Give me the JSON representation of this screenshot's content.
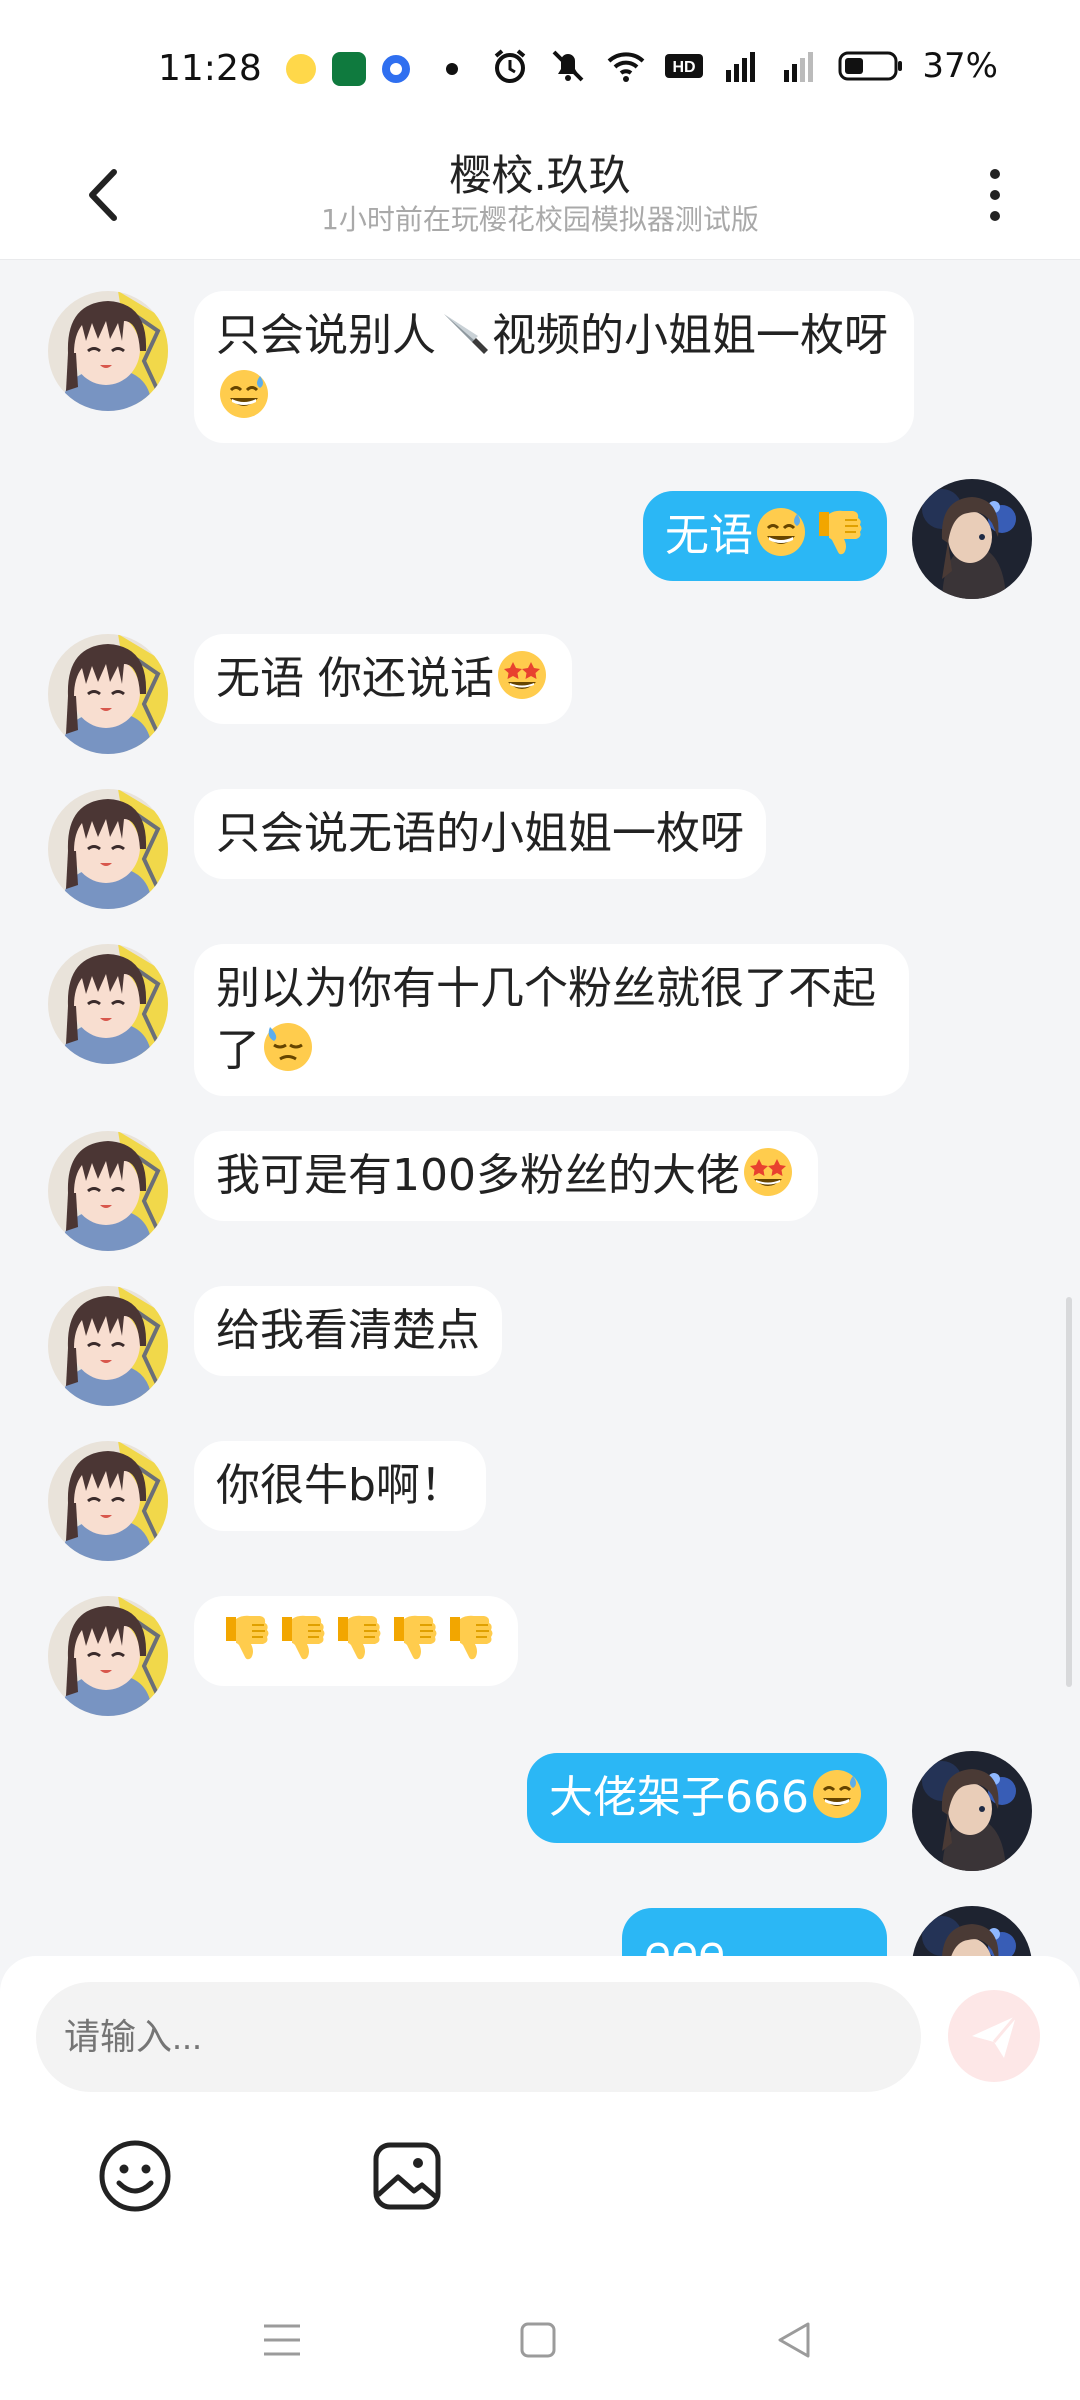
{
  "status_bar": {
    "time": "11:28",
    "battery": "37%"
  },
  "header": {
    "title": "樱校.玖玖",
    "subtitle": "1小时前在玩樱花校园模拟器测试版"
  },
  "messages": [
    {
      "side": "left",
      "text": "只会说别人",
      "emoji": "knife",
      "text2": "视频的小姐姐一枚呀",
      "emoji2": "sweat-smile"
    },
    {
      "side": "right",
      "text": "无语",
      "emojis": [
        "sweat-smile",
        "thumbs-down"
      ]
    },
    {
      "side": "left",
      "text": "无语 你还说话",
      "emojis": [
        "star-struck"
      ]
    },
    {
      "side": "left",
      "text": "只会说无语的小姐姐一枚呀"
    },
    {
      "side": "left",
      "text": "别以为你有十几个粉丝就很了不起了",
      "emojis": [
        "downcast-sweat"
      ]
    },
    {
      "side": "left",
      "text": "我可是有100多粉丝的大佬",
      "emojis": [
        "star-struck"
      ]
    },
    {
      "side": "left",
      "text": "给我看清楚点"
    },
    {
      "side": "left",
      "text": "你很牛b啊！"
    },
    {
      "side": "left",
      "text": "",
      "emojis": [
        "thumbs-down",
        "thumbs-down",
        "thumbs-down",
        "thumbs-down",
        "thumbs-down"
      ]
    },
    {
      "side": "right",
      "text": "大佬架子666",
      "emojis": [
        "sweat-smile"
      ]
    },
    {
      "side": "right",
      "text": "eee"
    }
  ],
  "input": {
    "placeholder": "请输入..."
  },
  "colors": {
    "accent_bubble": "#2bb7f5",
    "background": "#f4f5f7",
    "send_button": "#fde7e7"
  }
}
